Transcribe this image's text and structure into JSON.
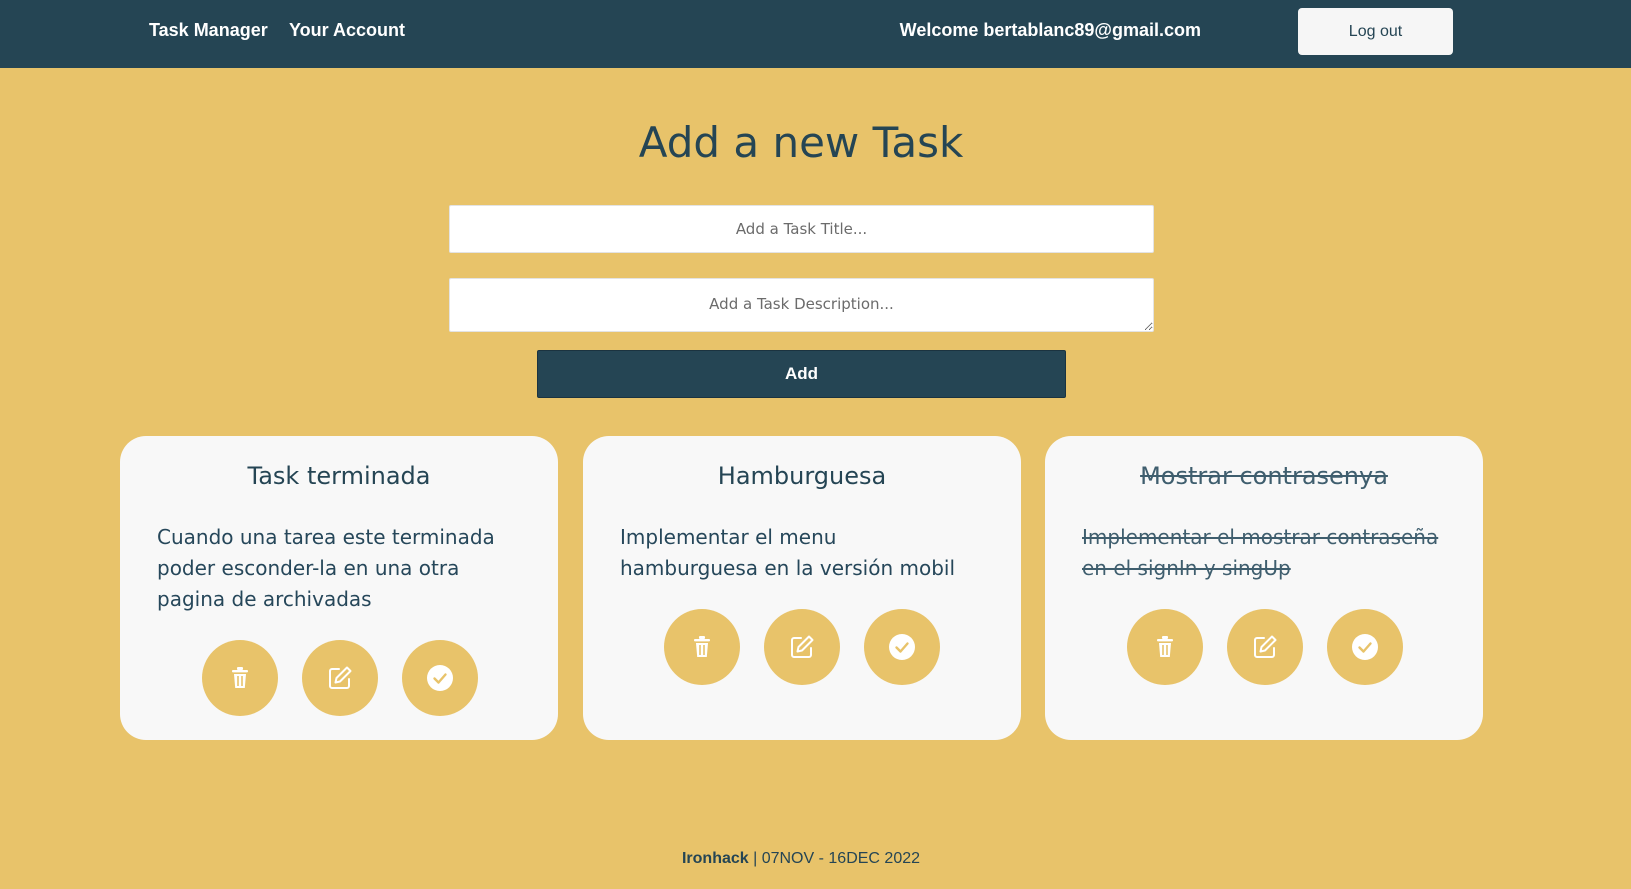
{
  "nav": {
    "task_manager": "Task Manager",
    "your_account": "Your Account",
    "welcome": "Welcome bertablanc89@gmail.com",
    "logout": "Log out"
  },
  "form": {
    "title": "Add a new Task",
    "title_placeholder": "Add a Task Title...",
    "desc_placeholder": "Add a Task Description...",
    "add_label": "Add"
  },
  "tasks": [
    {
      "title": "Task terminada",
      "description": "Cuando una tarea este terminada poder esconder-la en una otra pagina de archivadas",
      "completed": false
    },
    {
      "title": "Hamburguesa",
      "description": "Implementar el menu hamburguesa en la versión mobil",
      "completed": false
    },
    {
      "title": "Mostrar contrasenya",
      "description": "Implementar el mostrar contraseña en el signIn y singUp",
      "completed": true
    }
  ],
  "icons": [
    "trash-icon",
    "edit-icon",
    "check-circle-icon"
  ],
  "footer": {
    "brand": "Ironhack",
    "separator": " | ",
    "dates": "07NOV - 16DEC 2022"
  },
  "colors": {
    "background": "#e8c36a",
    "navbar": "#254554",
    "card": "#f8f8f8",
    "accent": "#e8c36a"
  }
}
